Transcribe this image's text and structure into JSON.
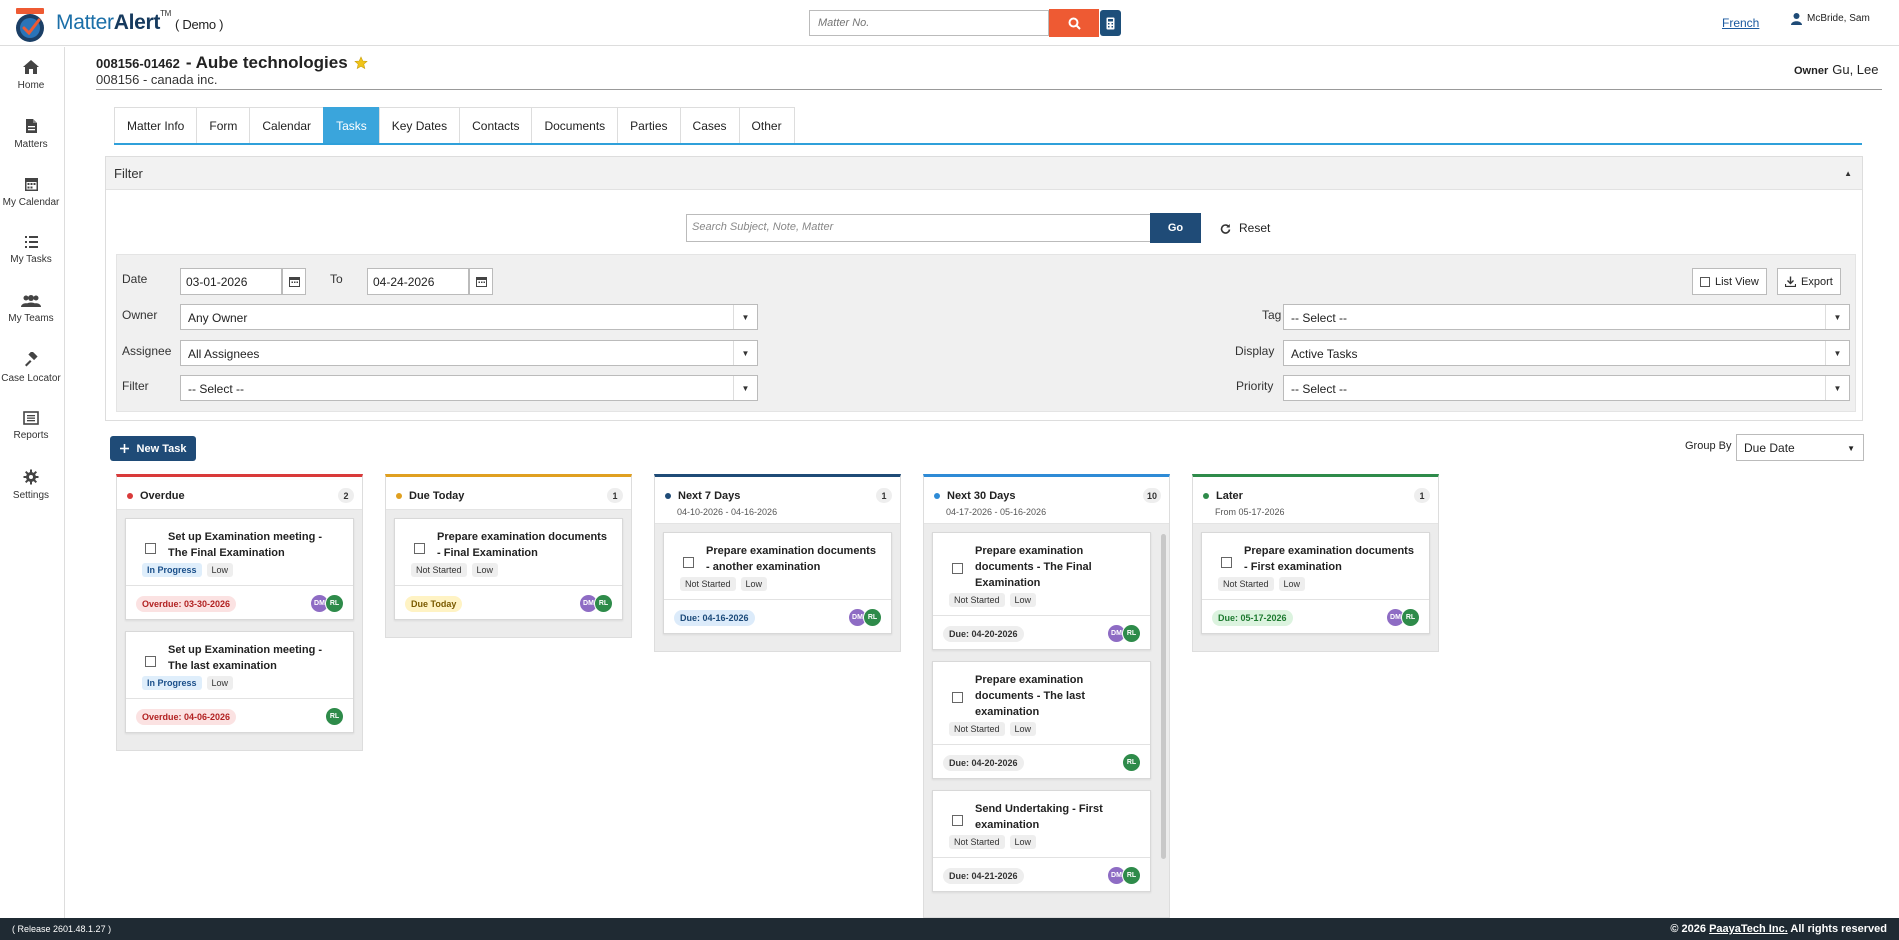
{
  "header": {
    "brand_prefix": "Matter",
    "brand_bold": "Alert",
    "brand_tm": "TM",
    "brand_suffix": "( Demo )",
    "matter_search_placeholder": "Matter No.",
    "language": "French",
    "user_name": "McBride, Sam",
    "accent_color": "#ee5a33"
  },
  "sidebar": {
    "items": [
      {
        "label": "Home",
        "icon": "home-icon"
      },
      {
        "label": "Matters",
        "icon": "document-icon"
      },
      {
        "label": "My Calendar",
        "icon": "calendar-icon"
      },
      {
        "label": "My Tasks",
        "icon": "list-icon"
      },
      {
        "label": "My Teams",
        "icon": "team-icon"
      },
      {
        "label": "Case Locator",
        "icon": "gavel-icon"
      },
      {
        "label": "Reports",
        "icon": "report-icon"
      },
      {
        "label": "Settings",
        "icon": "gear-icon"
      }
    ]
  },
  "matter": {
    "number": "008156-01462",
    "name": "- Aube technologies",
    "client": "008156 - canada inc.",
    "owner_label": "Owner",
    "owner_value": "Gu, Lee"
  },
  "tabs": [
    "Matter Info",
    "Form",
    "Calendar",
    "Tasks",
    "Key Dates",
    "Contacts",
    "Documents",
    "Parties",
    "Cases",
    "Other"
  ],
  "active_tab": "Tasks",
  "filter": {
    "title": "Filter",
    "search_placeholder": "Search Subject, Note, Matter",
    "go_label": "Go",
    "reset_label": "Reset",
    "date_label": "Date",
    "date_from": "03-01-2026",
    "to_label": "To",
    "date_to": "04-24-2026",
    "list_view_label": "List View",
    "export_label": "Export",
    "owner_label": "Owner",
    "owner_value": "Any Owner",
    "assignee_label": "Assignee",
    "assignee_value": "All Assignees",
    "filter_label": "Filter",
    "filter_value": "-- Select --",
    "tag_label": "Tag",
    "tag_value": "-- Select --",
    "display_label": "Display",
    "display_value": "Active Tasks",
    "priority_label": "Priority",
    "priority_value": "-- Select --"
  },
  "toolbar": {
    "new_task_label": "New Task",
    "group_by_label": "Group By",
    "group_by_value": "Due Date"
  },
  "columns": [
    {
      "title": "Overdue",
      "count": "2",
      "range": "",
      "color": "#d93a3a",
      "cards": [
        {
          "title": "Set up Examination meeting - The Final Examination",
          "status": "In Progress",
          "priority": "Low",
          "due": "Overdue: 03-30-2026",
          "avatars": [
            "DM",
            "RL"
          ]
        },
        {
          "title": "Set up Examination meeting - The last examination",
          "status": "In Progress",
          "priority": "Low",
          "due": "Overdue: 04-06-2026",
          "avatars": [
            "RL"
          ]
        }
      ]
    },
    {
      "title": "Due Today",
      "count": "1",
      "range": "",
      "color": "#e0a020",
      "cards": [
        {
          "title": "Prepare examination documents - Final Examination",
          "status": "Not Started",
          "priority": "Low",
          "due": "Due Today",
          "avatars": [
            "DM",
            "RL"
          ]
        }
      ]
    },
    {
      "title": "Next 7 Days",
      "count": "1",
      "range": "04-10-2026 - 04-16-2026",
      "color": "#1f4b77",
      "cards": [
        {
          "title": "Prepare examination documents - another examination",
          "status": "Not Started",
          "priority": "Low",
          "due": "Due: 04-16-2026",
          "avatars": [
            "DM",
            "RL"
          ]
        }
      ]
    },
    {
      "title": "Next 30 Days",
      "count": "10",
      "range": "04-17-2026 - 05-16-2026",
      "color": "#2e8bd6",
      "cards": [
        {
          "title": "Prepare examination documents - The Final Examination",
          "status": "Not Started",
          "priority": "Low",
          "due": "Due: 04-20-2026",
          "avatars": [
            "DM",
            "RL"
          ]
        },
        {
          "title": "Prepare examination documents - The last examination",
          "status": "Not Started",
          "priority": "Low",
          "due": "Due: 04-20-2026",
          "avatars": [
            "RL"
          ]
        },
        {
          "title": "Send Undertaking - First examination",
          "status": "Not Started",
          "priority": "Low",
          "due": "Due: 04-21-2026",
          "avatars": [
            "DM",
            "RL"
          ]
        }
      ]
    },
    {
      "title": "Later",
      "count": "1",
      "range": "From 05-17-2026",
      "color": "#2e8b4a",
      "cards": [
        {
          "title": "Prepare examination documents - First examination",
          "status": "Not Started",
          "priority": "Low",
          "due": "Due: 05-17-2026",
          "avatars": [
            "DM",
            "RL"
          ]
        }
      ]
    }
  ],
  "footer": {
    "release": "( Release 2601.48.1.27 )",
    "copyright_prefix": "© 2026",
    "company": "PaayaTech Inc.",
    "copyright_suffix": "All rights reserved"
  }
}
